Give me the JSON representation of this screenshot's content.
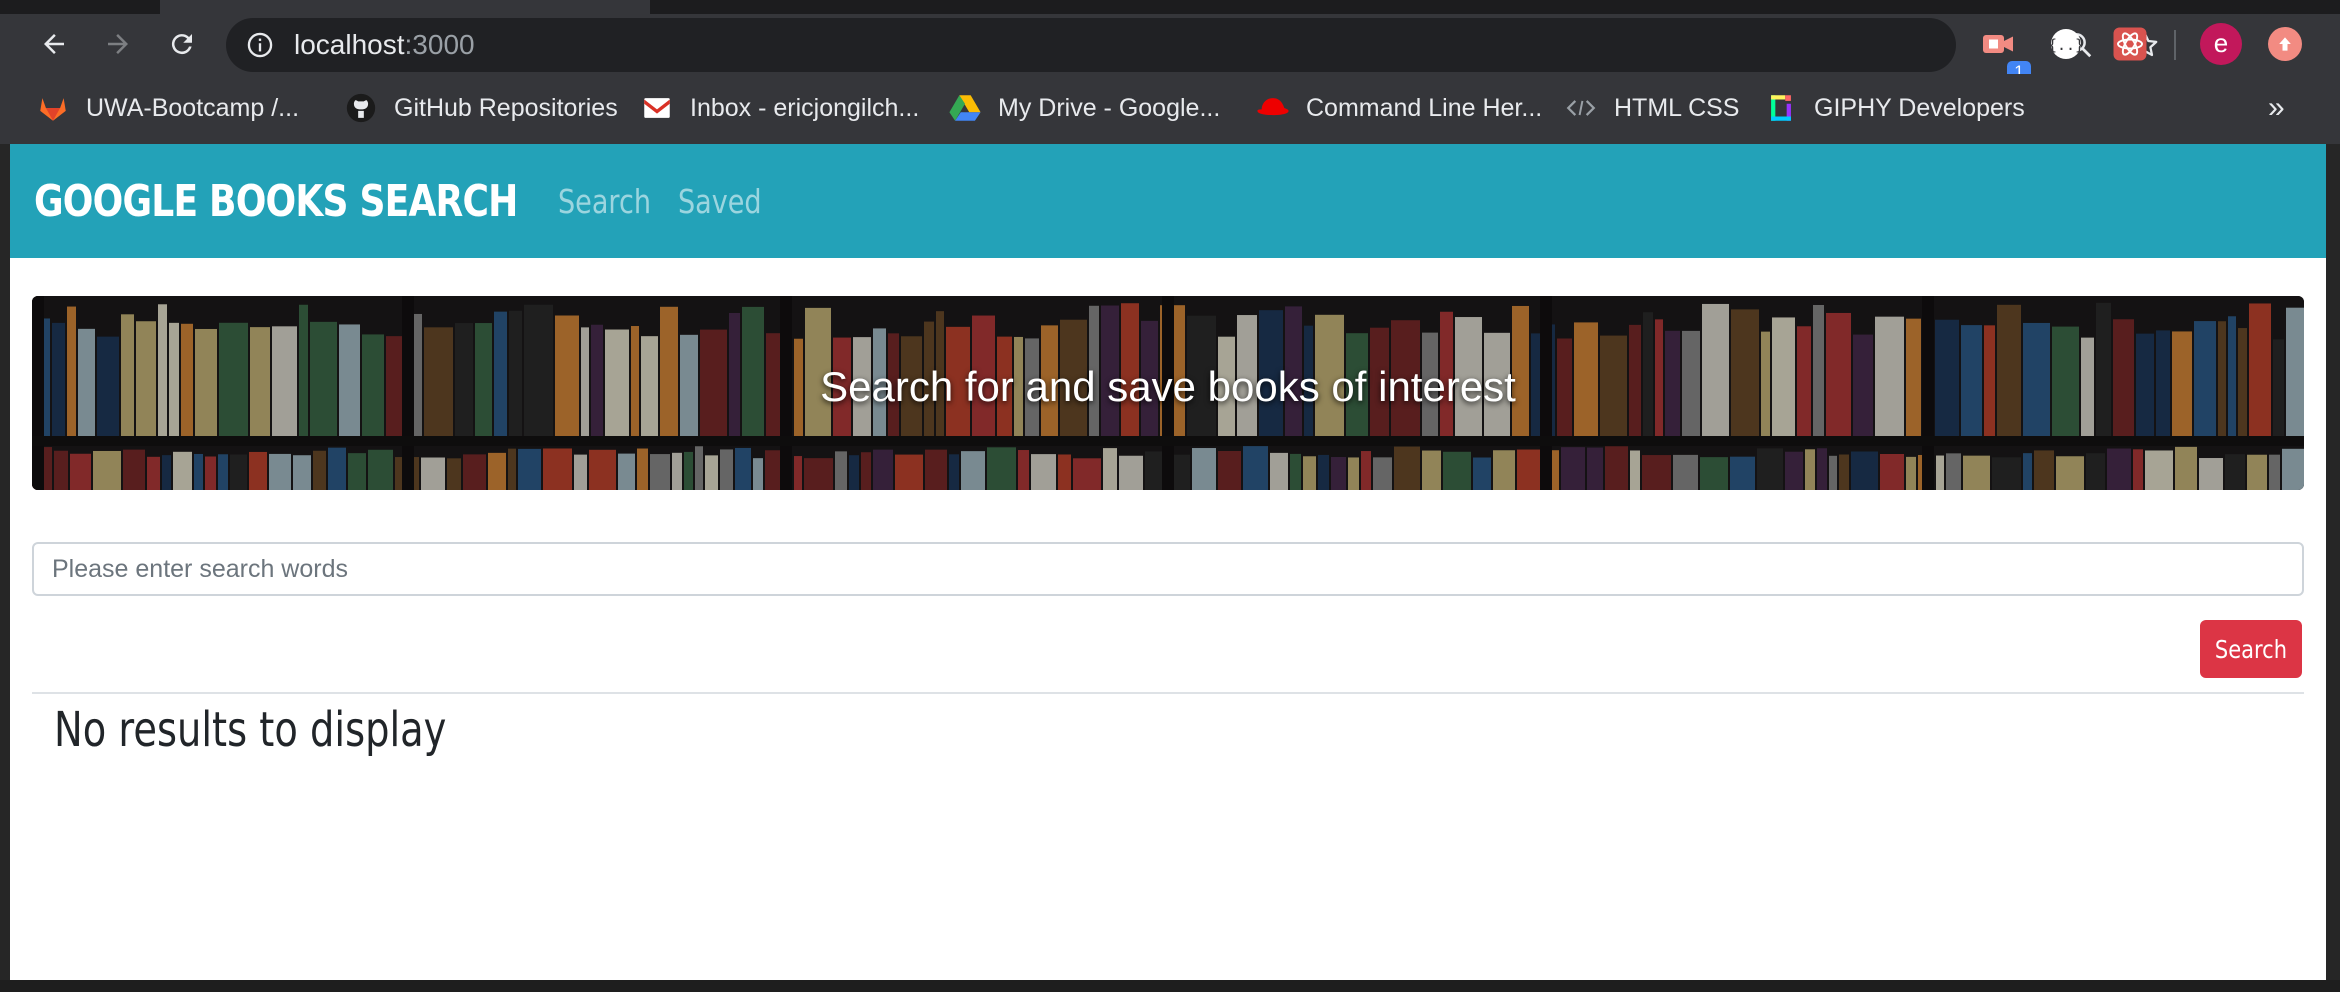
{
  "browser": {
    "url_host": "localhost",
    "url_port": ":3000",
    "extension_badge": "1",
    "profile_initial": "e",
    "bookmarks": [
      {
        "label": "UWA-Bootcamp /...",
        "icon": "gitlab-icon"
      },
      {
        "label": "GitHub Repositories",
        "icon": "github-icon"
      },
      {
        "label": "Inbox - ericjongilch...",
        "icon": "gmail-icon"
      },
      {
        "label": "My Drive - Google...",
        "icon": "google-drive-icon"
      },
      {
        "label": "Command Line Her...",
        "icon": "redhat-icon"
      },
      {
        "label": "HTML CSS",
        "icon": "code-icon"
      },
      {
        "label": "GIPHY Developers",
        "icon": "giphy-icon"
      }
    ],
    "bookmarks_more": "»"
  },
  "app": {
    "brand": "GOOGLE BOOKS SEARCH",
    "nav": [
      {
        "label": "Search"
      },
      {
        "label": "Saved"
      }
    ],
    "jumbotron_text": "Search for and save books of interest",
    "search_placeholder": "Please enter search words",
    "search_value": "",
    "search_button": "Search",
    "no_results": "No results to display",
    "colors": {
      "navbar": "#23a2b8",
      "search_button": "#dc3545"
    }
  }
}
